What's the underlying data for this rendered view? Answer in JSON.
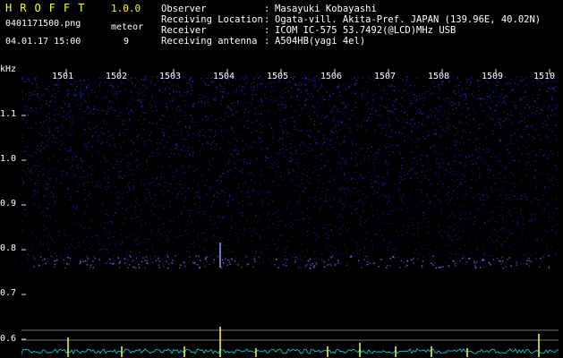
{
  "header": {
    "brand": "HROFFT",
    "version": "1.0.0",
    "filename": "0401171500.png",
    "timestamp": "04.01.17 15:00",
    "count_label": "meteor",
    "count_value": "9"
  },
  "info": [
    {
      "key": "Observer",
      "value": "Masayuki Kobayashi"
    },
    {
      "key": "Receiving Location",
      "value": "Ogata-vill. Akita-Pref. JAPAN (139.96E, 40.02N)"
    },
    {
      "key": "Receiver",
      "value": "ICOM IC-575 53.7492(@LCD)MHz USB"
    },
    {
      "key": "Receiving antenna",
      "value": "A504HB(yagi 4el)"
    }
  ],
  "axis": {
    "y_unit": "kHz",
    "y_ticks": [
      "1.1",
      "1.0",
      "0.9",
      "0.8",
      "0.7",
      "0.6"
    ],
    "x_ticks": [
      "1501",
      "1502",
      "1503",
      "1504",
      "1505",
      "1506",
      "1507",
      "1508",
      "1509",
      "1510"
    ]
  },
  "colors": {
    "background": "#000000",
    "brand": "#ffff00",
    "noise": "#2a36ff",
    "trace": "#00e0e0",
    "spike": "#ffff40",
    "tick": "#e0e0e0"
  }
}
